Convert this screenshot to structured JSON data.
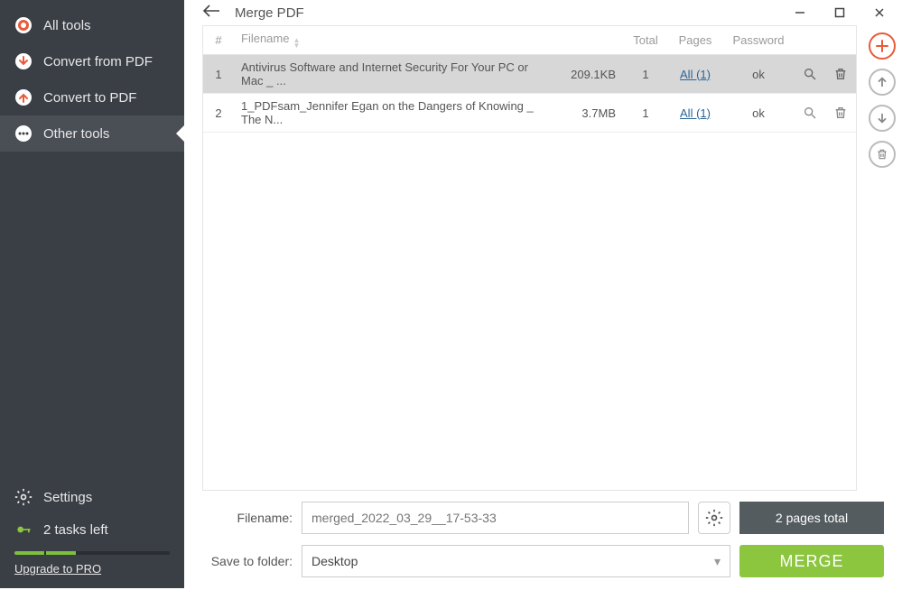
{
  "sidebar": {
    "items": [
      {
        "label": "All tools"
      },
      {
        "label": "Convert from PDF"
      },
      {
        "label": "Convert to PDF"
      },
      {
        "label": "Other tools"
      }
    ],
    "settings_label": "Settings",
    "tasks_label": "2 tasks left",
    "upgrade_label": "Upgrade to PRO"
  },
  "header": {
    "title": "Merge PDF"
  },
  "table": {
    "headers": {
      "num": "#",
      "filename": "Filename",
      "total": "Total",
      "pages": "Pages",
      "password": "Password"
    },
    "rows": [
      {
        "num": "1",
        "filename": "Antivirus Software and Internet Security For Your PC or Mac _ ...",
        "size": "209.1KB",
        "total": "1",
        "pages": "All (1)",
        "password": "ok"
      },
      {
        "num": "2",
        "filename": "1_PDFsam_Jennifer Egan on the Dangers of Knowing _ The N...",
        "size": "3.7MB",
        "total": "1",
        "pages": "All (1)",
        "password": "ok"
      }
    ]
  },
  "form": {
    "filename_label": "Filename:",
    "filename_placeholder": "merged_2022_03_29__17-53-33",
    "savefolder_label": "Save to folder:",
    "savefolder_value": "Desktop",
    "pages_total": "2 pages total",
    "merge_label": "MERGE"
  }
}
